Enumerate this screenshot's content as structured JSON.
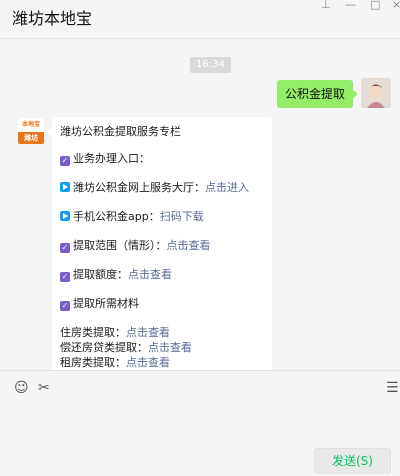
{
  "window": {
    "title": "潍坊本地宝"
  },
  "chat": {
    "timestamp": "16:34",
    "outgoing": {
      "text": "公积金提取"
    },
    "incoming": {
      "avatar_top": "本地宝",
      "avatar_bottom": "潍坊",
      "heading": "潍坊公积金提取服务专栏",
      "lines": [
        {
          "icon": "checkbox-icon",
          "text": "业务办理入口：",
          "link": ""
        },
        {
          "icon": "play-icon",
          "text": "潍坊公积金网上服务大厅：",
          "link": "点击进入"
        },
        {
          "icon": "play-icon",
          "text": "手机公积金app：",
          "link": "扫码下载"
        },
        {
          "icon": "checkbox-icon",
          "text": "提取范围（情形）：",
          "link": "点击查看"
        },
        {
          "icon": "checkbox-icon",
          "text": "提取额度：",
          "link": "点击查看"
        },
        {
          "icon": "checkbox-icon",
          "text": "提取所需材料",
          "link": ""
        }
      ],
      "tail_lines": [
        {
          "text": "住房类提取：",
          "link": "点击查看"
        },
        {
          "text": "偿还房贷类提取：",
          "link": "点击查看"
        },
        {
          "text": "租房类提取：",
          "link": "点击查看"
        }
      ]
    }
  },
  "input": {
    "send_label": "发送(S)",
    "accent": "#07c160",
    "bubble_out": "#95ec69",
    "link_color": "#576b95"
  }
}
